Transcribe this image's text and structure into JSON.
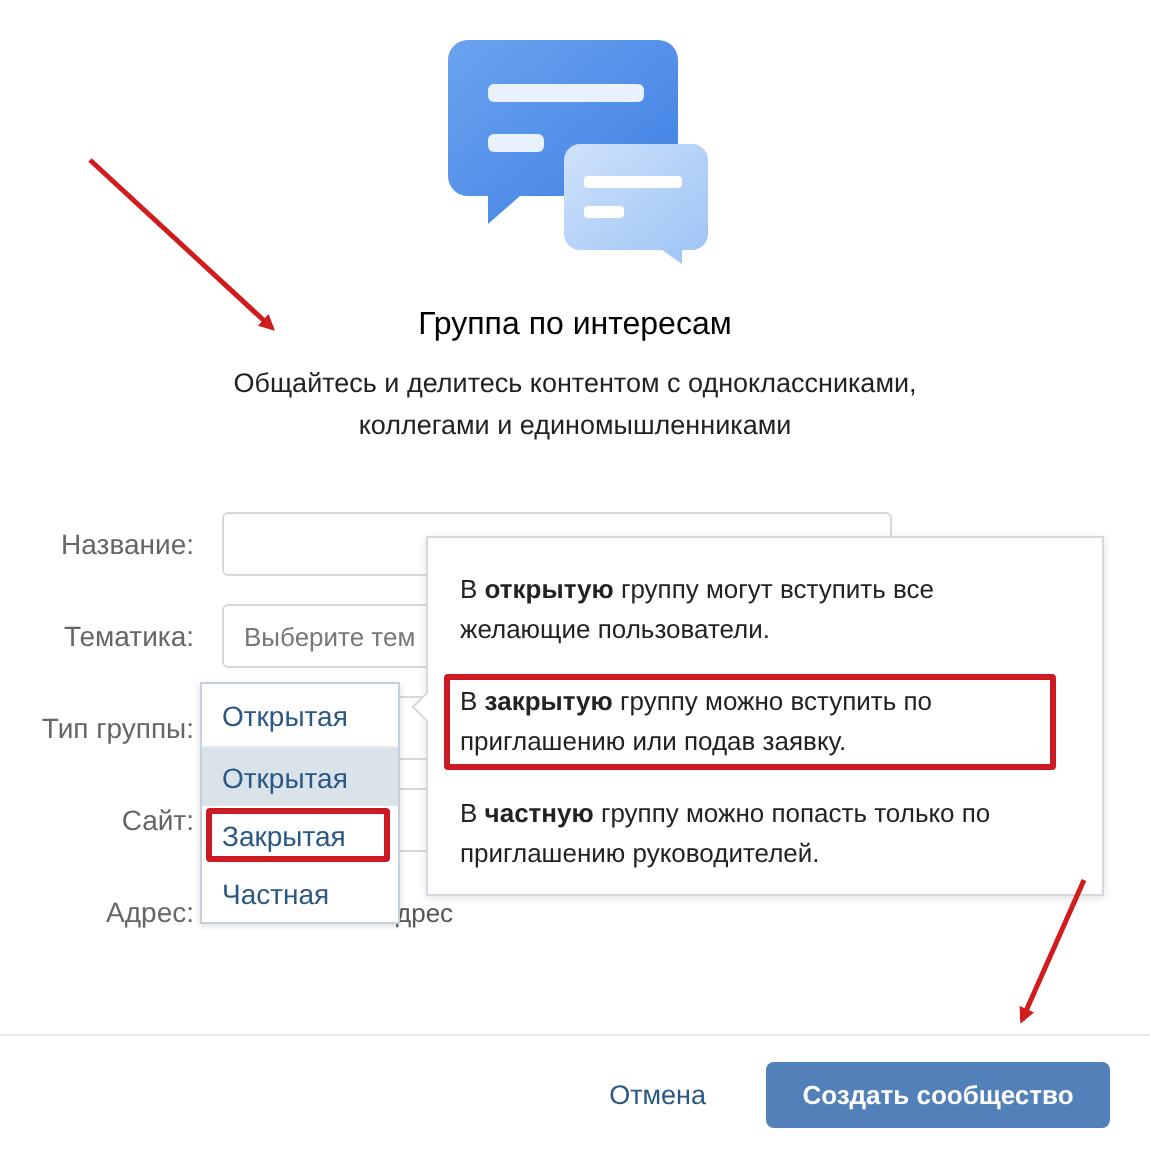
{
  "header": {
    "title": "Группа по интересам",
    "subtitle": "Общайтесь и делитесь контентом с одноклассниками, коллегами и единомышленниками"
  },
  "form": {
    "fields": [
      {
        "label": "Название:"
      },
      {
        "label": "Тематика:",
        "placeholder": "Выберите тем"
      },
      {
        "label": "Тип группы:"
      },
      {
        "label": "Сайт:"
      },
      {
        "label": "Адрес:",
        "placeholder": "дрес"
      }
    ]
  },
  "group_type_dropdown": {
    "value": "Открытая",
    "options": [
      {
        "label": "Открытая",
        "selected": true,
        "highlighted": false
      },
      {
        "label": "Закрытая",
        "selected": false,
        "highlighted": true
      },
      {
        "label": "Частная",
        "selected": false,
        "highlighted": false
      }
    ]
  },
  "tooltip": {
    "paragraphs": [
      {
        "text": "В **открытую** группу могут вступить все желающие пользователи.",
        "highlighted": false
      },
      {
        "text": "В **закрытую** группу можно вступить по приглашению или подав заявку.",
        "highlighted": true
      },
      {
        "text": "В **частную** группу можно попасть только по приглашению руководителей.",
        "highlighted": false
      }
    ]
  },
  "footer": {
    "cancel": "Отмена",
    "submit": "Создать сообщество"
  }
}
